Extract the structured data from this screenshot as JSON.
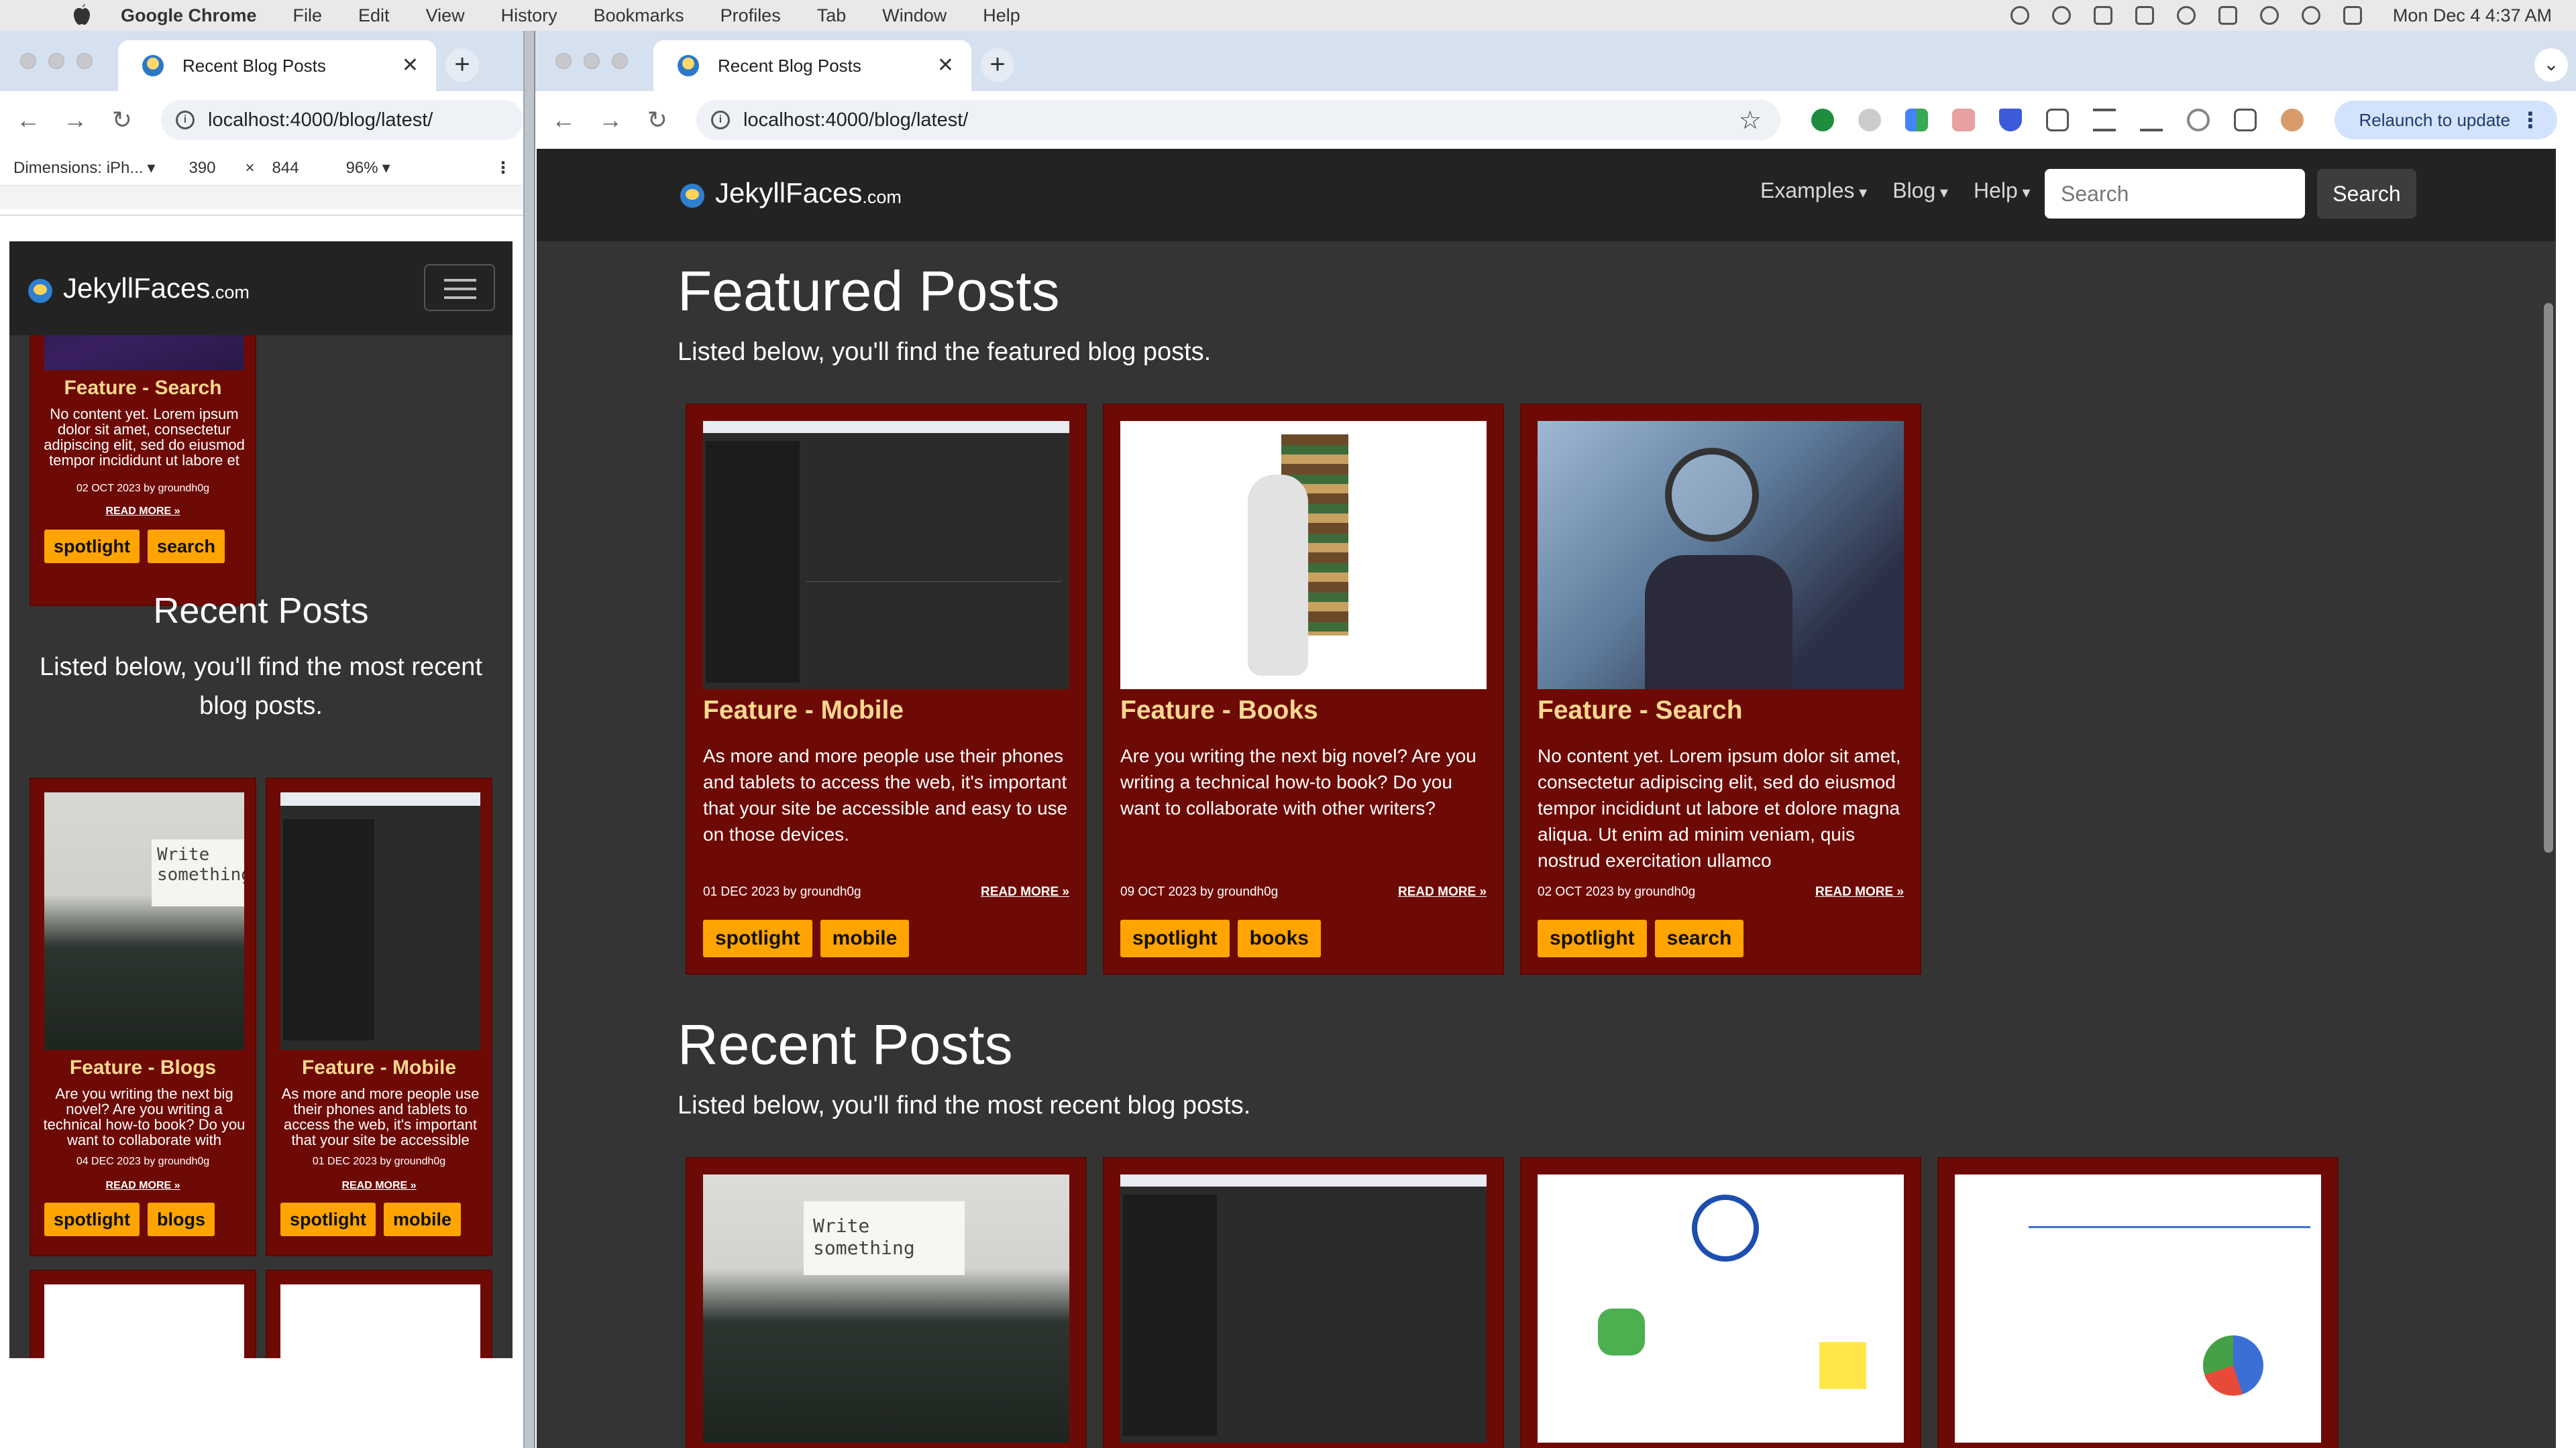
{
  "menubar": {
    "app": "Google Chrome",
    "items": [
      "File",
      "Edit",
      "View",
      "History",
      "Bookmarks",
      "Profiles",
      "Tab",
      "Window",
      "Help"
    ],
    "clock": "Mon Dec 4  4:37 AM"
  },
  "left_window": {
    "tab_title": "Recent Blog Posts",
    "url": "localhost:4000/blog/latest/",
    "devtools": {
      "device": "Dimensions: iPh...",
      "width": "390",
      "times": "×",
      "height": "844",
      "zoom": "96%"
    },
    "site": {
      "brand": "JekyllFaces",
      "tld": ".com",
      "partial_card": {
        "title": "Feature - Search",
        "body": "No content yet. Lorem ipsum dolor sit amet, consectetur adipiscing elit, sed do eiusmod tempor incididunt ut labore et",
        "meta": "02 OCT 2023 by groundh0g",
        "more": "READ MORE »",
        "tags": [
          "spotlight",
          "search"
        ]
      },
      "recent_heading": "Recent Posts",
      "recent_lead": "Listed below, you'll find the most recent blog posts.",
      "cards": [
        {
          "title": "Feature - Blogs",
          "body": "Are you writing the next big novel? Are you writing a technical how-to book? Do you want to collaborate with",
          "meta": "04 DEC 2023 by groundh0g",
          "more": "READ MORE »",
          "tags": [
            "spotlight",
            "blogs"
          ]
        },
        {
          "title": "Feature - Mobile",
          "body": "As more and more people use their phones and tablets to access the web, it's important that your site be accessible",
          "meta": "01 DEC 2023 by groundh0g",
          "more": "READ MORE »",
          "tags": [
            "spotlight",
            "mobile"
          ]
        }
      ]
    }
  },
  "right_window": {
    "tab_title": "Recent Blog Posts",
    "url": "localhost:4000/blog/latest/",
    "relaunch": "Relaunch to update",
    "site": {
      "brand": "JekyllFaces",
      "tld": ".com",
      "nav": [
        "Examples",
        "Blog",
        "Help"
      ],
      "search_placeholder": "Search",
      "search_button": "Search",
      "featured_heading": "Featured Posts",
      "featured_lead": "Listed below, you'll find the featured blog posts.",
      "featured": [
        {
          "title": "Feature - Mobile",
          "body": "As more and more people use their phones and tablets to access the web, it's important that your site be accessible and easy to use on those devices.",
          "meta": "01 DEC 2023 by groundh0g",
          "more": "READ MORE »",
          "tags": [
            "spotlight",
            "mobile"
          ]
        },
        {
          "title": "Feature - Books",
          "body": "Are you writing the next big novel? Are you writing a technical how-to book? Do you want to collaborate with other writers?",
          "meta": "09 OCT 2023 by groundh0g",
          "more": "READ MORE »",
          "tags": [
            "spotlight",
            "books"
          ]
        },
        {
          "title": "Feature - Search",
          "body": "No content yet. Lorem ipsum dolor sit amet, consectetur adipiscing elit, sed do eiusmod tempor incididunt ut labore et dolore magna aliqua. Ut enim ad minim veniam, quis nostrud exercitation ullamco",
          "meta": "02 OCT 2023 by groundh0g",
          "more": "READ MORE »",
          "tags": [
            "spotlight",
            "search"
          ]
        }
      ],
      "recent_heading": "Recent Posts",
      "recent_lead": "Listed below, you'll find the most recent blog posts.",
      "typewriter_text": "Write something"
    }
  },
  "colors": {
    "card_bg": "#6e0a05",
    "card_title": "#ffd98e",
    "tag_bg": "#ffa400",
    "page_bg": "#343434",
    "nav_bg": "#232323"
  }
}
